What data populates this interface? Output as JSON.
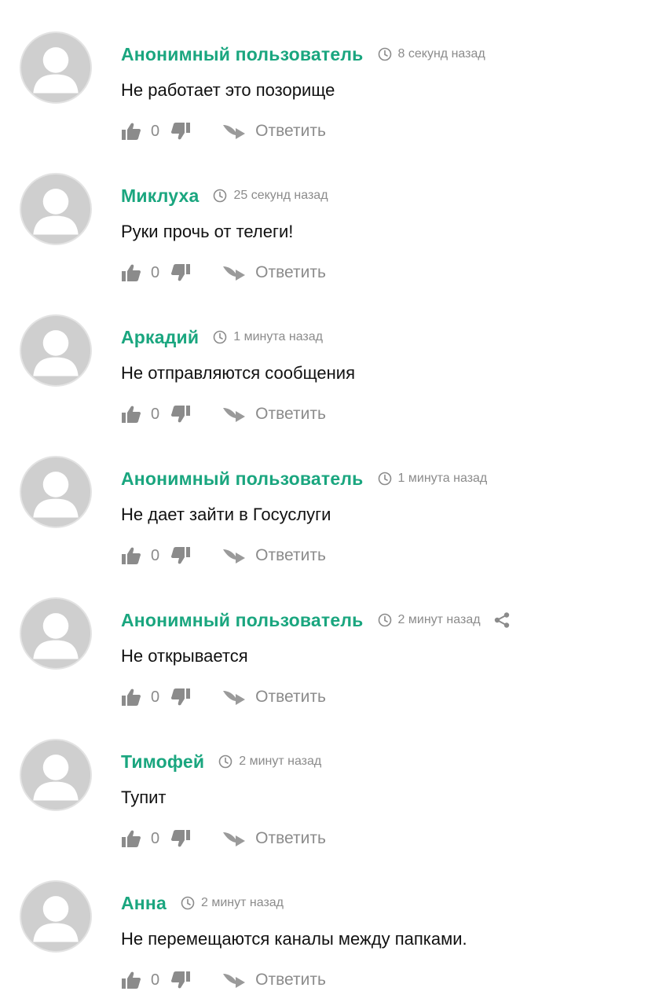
{
  "colors": {
    "author": "#1aa67f",
    "muted": "#8b8b8b",
    "text": "#111111",
    "avatar": "#cfcfcf"
  },
  "icons": {
    "avatar": "user-silhouette-icon",
    "time": "clock-icon",
    "like": "thumbs-up-icon",
    "dislike": "thumbs-down-icon",
    "reply": "reply-arrow-icon",
    "share": "share-icon"
  },
  "comments": [
    {
      "author": "Анонимный пользователь",
      "time": "8 секунд назад",
      "text": "Не работает это позорище",
      "likes": "0",
      "reply_label": "Ответить"
    },
    {
      "author": "Миклуха",
      "time": "25 секунд назад",
      "text": "Руки прочь от телеги!",
      "likes": "0",
      "reply_label": "Ответить"
    },
    {
      "author": "Аркадий",
      "time": "1 минута назад",
      "text": "Не отправляются сообщения",
      "likes": "0",
      "reply_label": "Ответить"
    },
    {
      "author": "Анонимный пользователь",
      "time": "1 минута назад",
      "text": "Не дает зайти в Госуслуги",
      "likes": "0",
      "reply_label": "Ответить"
    },
    {
      "author": "Анонимный пользователь",
      "time": "2 минут назад",
      "text": "Не открывается",
      "likes": "0",
      "reply_label": "Ответить"
    },
    {
      "author": "Тимофей",
      "time": "2 минут назад",
      "text": "Тупит",
      "likes": "0",
      "reply_label": "Ответить"
    },
    {
      "author": "Анна",
      "time": "2 минут назад",
      "text": "Не перемещаются каналы между папками.",
      "likes": "0",
      "reply_label": "Ответить"
    }
  ]
}
